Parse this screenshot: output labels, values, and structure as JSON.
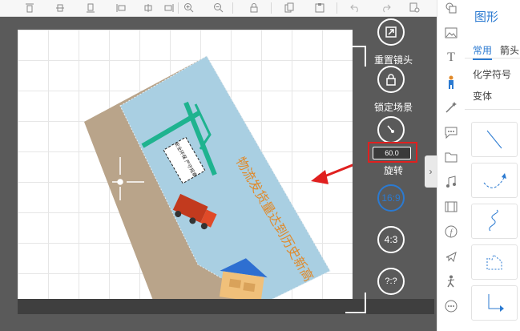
{
  "toolbar": {
    "buttons": [
      "align-top-icon",
      "align-center-v-icon",
      "align-bottom-icon",
      "align-left-icon",
      "align-center-h-icon",
      "align-right-icon",
      "zoom-in-icon",
      "zoom-out-icon",
      "lock-icon",
      "copy-icon",
      "paste-icon",
      "undo-icon",
      "redo-icon",
      "settings-doc-icon"
    ]
  },
  "controls": {
    "reset_camera_label": "重置镜头",
    "lock_scene_label": "锁定场景",
    "rotate_label": "旋转",
    "angle_value": "60.0",
    "ratio_16_9": "16:9",
    "ratio_4_3": "4:3",
    "ratio_custom": "?:?"
  },
  "slide": {
    "headline": "物流发货量达到历史新高",
    "sign_text": "安全环保 严守规章"
  },
  "panel": {
    "title": "图形",
    "tabs": [
      "常用",
      "箭头"
    ],
    "menu": [
      "化学符号",
      "变体"
    ]
  },
  "colors": {
    "accent_blue": "#2b7ad1",
    "highlight_red": "#e0201f",
    "slide_blue": "#a9cfe2",
    "ground_tan": "#b9a48a",
    "crane_green": "#1fb38f",
    "headline_orange": "#e0892a"
  }
}
